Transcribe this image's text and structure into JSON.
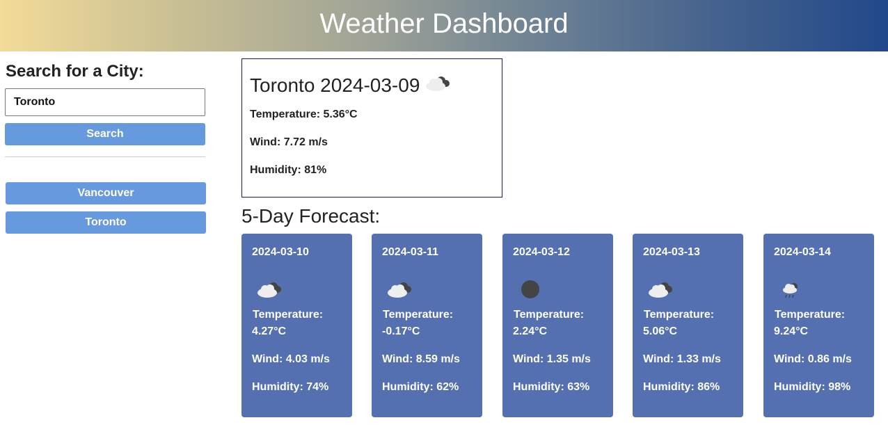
{
  "header": {
    "title": "Weather Dashboard"
  },
  "sidebar": {
    "title": "Search for a City:",
    "search_value": "Toronto",
    "search_label": "Search",
    "history": [
      "Vancouver",
      "Toronto"
    ]
  },
  "current": {
    "title": "Toronto 2024-03-09",
    "icon": "broken-clouds-icon",
    "temperature": "Temperature: 5.36°C",
    "wind": "Wind: 7.72 m/s",
    "humidity": "Humidity: 81%"
  },
  "forecast": {
    "title": "5-Day Forecast:",
    "temp_label": "Temperature:",
    "days": [
      {
        "date": "2024-03-10",
        "icon": "broken-clouds-icon",
        "temp": "4.27°C",
        "wind": "Wind: 4.03 m/s",
        "humidity": "Humidity: 74%"
      },
      {
        "date": "2024-03-11",
        "icon": "broken-clouds-icon",
        "temp": "-0.17°C",
        "wind": "Wind: 8.59 m/s",
        "humidity": "Humidity: 62%"
      },
      {
        "date": "2024-03-12",
        "icon": "clear-night-icon",
        "temp": "2.24°C",
        "wind": "Wind: 1.35 m/s",
        "humidity": "Humidity: 63%"
      },
      {
        "date": "2024-03-13",
        "icon": "broken-clouds-icon",
        "temp": "5.06°C",
        "wind": "Wind: 1.33 m/s",
        "humidity": "Humidity: 86%"
      },
      {
        "date": "2024-03-14",
        "icon": "rain-icon",
        "temp": "9.24°C",
        "wind": "Wind: 0.86 m/s",
        "humidity": "Humidity: 98%"
      }
    ]
  },
  "colors": {
    "accent": "#6699dd",
    "card": "#5470b0",
    "header_start": "#f2db98",
    "header_end": "#21488a"
  }
}
